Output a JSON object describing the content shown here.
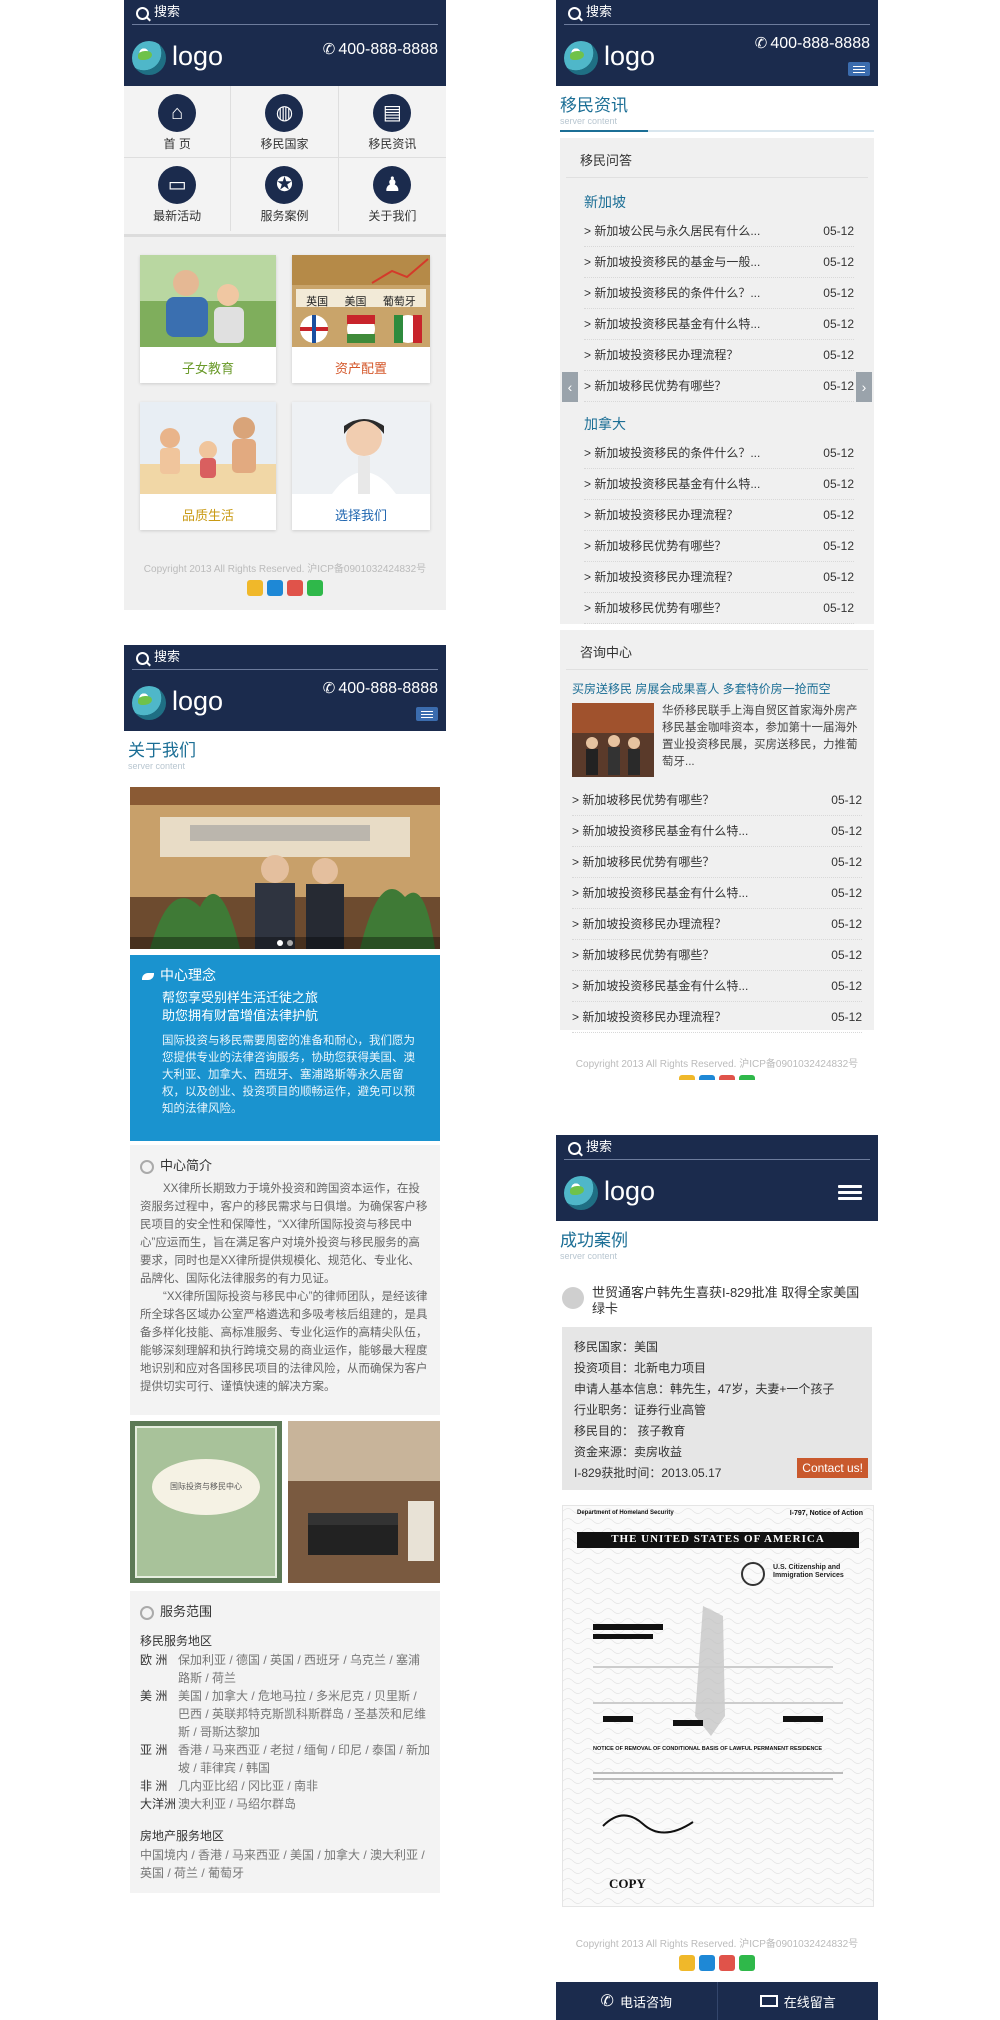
{
  "common": {
    "search_placeholder": "搜索",
    "logo_text": "logo",
    "phone": "400-888-8888",
    "copyright": "Copyright 2013 All Rights Reserved. 沪ICP备0901032424832号"
  },
  "home": {
    "nav": [
      {
        "label": "首 页",
        "icon": "home-icon"
      },
      {
        "label": "移民国家",
        "icon": "globe-icon"
      },
      {
        "label": "移民资讯",
        "icon": "news-icon"
      },
      {
        "label": "最新活动",
        "icon": "tv-icon"
      },
      {
        "label": "服务案例",
        "icon": "medal-icon"
      },
      {
        "label": "关于我们",
        "icon": "people-icon"
      }
    ],
    "cards": [
      {
        "label": "子女教育",
        "color": "#6a9a2a"
      },
      {
        "label": "资产配置",
        "color": "#d4572a"
      },
      {
        "label": "品质生活",
        "color": "#c99a14"
      },
      {
        "label": "选择我们",
        "color": "#2066b0"
      }
    ],
    "flags": [
      "英国",
      "美国",
      "葡萄牙"
    ]
  },
  "news": {
    "title": "移民资讯",
    "subtitle": "server content",
    "qa_heading": "移民问答",
    "groups": [
      {
        "name": "新加坡",
        "items": [
          {
            "text": "> 新加坡公民与永久居民有什么...",
            "date": "05-12"
          },
          {
            "text": "> 新加坡投资移民的基金与一般...",
            "date": "05-12"
          },
          {
            "text": "> 新加坡投资移民的条件什么？...",
            "date": "05-12"
          },
          {
            "text": "> 新加坡投资移民基金有什么特...",
            "date": "05-12"
          },
          {
            "text": "> 新加坡投资移民办理流程？",
            "date": "05-12"
          },
          {
            "text": "> 新加坡移民优势有哪些？",
            "date": "05-12"
          }
        ]
      },
      {
        "name": "加拿大",
        "items": [
          {
            "text": "> 新加坡投资移民的条件什么？...",
            "date": "05-12"
          },
          {
            "text": "> 新加坡投资移民基金有什么特...",
            "date": "05-12"
          },
          {
            "text": "> 新加坡投资移民办理流程？",
            "date": "05-12"
          },
          {
            "text": "> 新加坡移民优势有哪些？",
            "date": "05-12"
          },
          {
            "text": "> 新加坡投资移民办理流程？",
            "date": "05-12"
          },
          {
            "text": "> 新加坡移民优势有哪些？",
            "date": "05-12"
          }
        ]
      }
    ],
    "consult_heading": "咨询中心",
    "headline": "买房送移民 房展会成果喜人 多套特价房一抢而空",
    "headline_body": "华侨移民联手上海自贸区首家海外房产移民基金咖啡资本，参加第十一届海外置业投资移民展，买房送移民，力推葡萄牙...",
    "consult_items": [
      {
        "text": "> 新加坡移民优势有哪些？",
        "date": "05-12"
      },
      {
        "text": "> 新加坡投资移民基金有什么特...",
        "date": "05-12"
      },
      {
        "text": "> 新加坡移民优势有哪些？",
        "date": "05-12"
      },
      {
        "text": "> 新加坡投资移民基金有什么特...",
        "date": "05-12"
      },
      {
        "text": "> 新加坡投资移民办理流程？",
        "date": "05-12"
      },
      {
        "text": "> 新加坡移民优势有哪些？",
        "date": "05-12"
      },
      {
        "text": "> 新加坡投资移民基金有什么特...",
        "date": "05-12"
      },
      {
        "text": "> 新加坡投资移民办理流程？",
        "date": "05-12"
      }
    ]
  },
  "about": {
    "title": "关于我们",
    "subtitle": "server content",
    "concept_heading": "中心理念",
    "concept_lines": [
      "帮您享受别样生活迁徙之旅",
      "助您拥有财富增值法律护航"
    ],
    "concept_body": "国际投资与移民需要周密的准备和耐心，我们愿为您提供专业的法律咨询服务，协助您获得美国、澳大利亚、加拿大、西班牙、塞浦路斯等永久居留权，以及创业、投资项目的顺畅运作，避免可以预知的法律风险。",
    "intro_heading": "中心简介",
    "intro_p1": "XX律所长期致力于境外投资和跨国资本运作，在投资服务过程中，客户的移民需求与日俱增。为确保客户移民项目的安全性和保障性，“XX律所国际投资与移民中心”应运而生，旨在满足客户对境外投资与移民服务的高要求，同时也是XX律所提供规模化、规范化、专业化、品牌化、国际化法律服务的有力见证。",
    "intro_p2": "“XX律所国际投资与移民中心”的律师团队，是经该律所全球各区域办公室严格遴选和多吸考核后组建的，是具备多样化技能、高标准服务、专业化运作的高精尖队伍，能够深刻理解和执行跨境交易的商业运作，能够最大程度地识别和应对各国移民项目的法律风险，从而确保为客户提供切实可行、谨慎快速的解决方案。",
    "plaque_text": "国际投资与移民中心",
    "scope_heading": "服务范围",
    "scope_subheading": "移民服务地区",
    "regions": [
      {
        "name": "欧 洲",
        "list": "保加利亚 / 德国 / 英国 / 西班牙 / 乌克兰 / 塞浦路斯 / 荷兰"
      },
      {
        "name": "美 洲",
        "list": "美国 / 加拿大 / 危地马拉 / 多米尼克 / 贝里斯 / 巴西 / 英联邦特克斯凯科斯群岛 / 圣基茨和尼维斯 / 哥斯达黎加"
      },
      {
        "name": "亚 洲",
        "list": "香港 / 马来西亚 / 老挝 / 缅甸 / 印尼 / 泰国 / 新加坡 / 菲律宾 / 韩国"
      },
      {
        "name": "非 洲",
        "list": "几内亚比绍 / 冈比亚 / 南非"
      },
      {
        "name": "大洋洲",
        "list": "澳大利亚 / 马绍尔群岛"
      }
    ],
    "property_heading": "房地产服务地区",
    "property_list": "中国境内 / 香港 / 马来西亚 / 美国 / 加拿大 / 澳大利亚 / 英国 / 荷兰 / 葡萄牙"
  },
  "cases": {
    "title": "成功案例",
    "subtitle": "server content",
    "case_title": "世贸通客户韩先生喜获I-829批准 取得全家美国绿卡",
    "details": [
      "移民国家：美国",
      "投资项目：北新电力项目",
      "申请人基本信息：韩先生，47岁，夫妻+一个孩子",
      "行业职务：证券行业高管",
      "移民目的： 孩子教育",
      "资金来源：卖房收益",
      "I-829获批时间：2013.05.17"
    ],
    "contact_button": "Contact us!",
    "doc": {
      "dept": "Department of Homeland Security",
      "agency": "U.S. Citizenship and Immigration Services",
      "form": "I-797, Notice of Action",
      "banner": "THE UNITED STATES OF AMERICA",
      "notice": "NOTICE OF REMOVAL OF CONDITIONAL BASIS OF LAWFUL PERMANENT RESIDENCE",
      "copy": "COPY"
    },
    "bottom_call": "电话咨询",
    "bottom_msg": "在线留言"
  }
}
